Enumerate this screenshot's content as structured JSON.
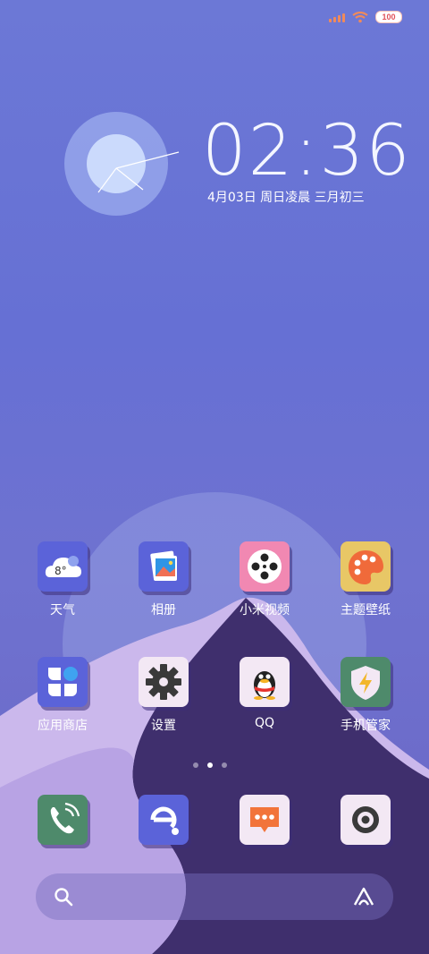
{
  "status": {
    "battery": "100"
  },
  "clock": {
    "time": "02:36",
    "date": "4月03日 周日凌晨 三月初三"
  },
  "apps": [
    {
      "label": "天气",
      "icon": "weather-icon",
      "badge": "8°"
    },
    {
      "label": "相册",
      "icon": "gallery-icon"
    },
    {
      "label": "小米视频",
      "icon": "video-icon"
    },
    {
      "label": "主题壁纸",
      "icon": "theme-icon"
    },
    {
      "label": "应用商店",
      "icon": "app-store-icon"
    },
    {
      "label": "设置",
      "icon": "settings-icon"
    },
    {
      "label": "QQ",
      "icon": "qq-icon"
    },
    {
      "label": "手机管家",
      "icon": "security-icon"
    }
  ],
  "dock": [
    "phone-icon",
    "browser-icon",
    "messages-icon",
    "camera-icon"
  ],
  "colors": {
    "accent": "#5b63d9"
  }
}
